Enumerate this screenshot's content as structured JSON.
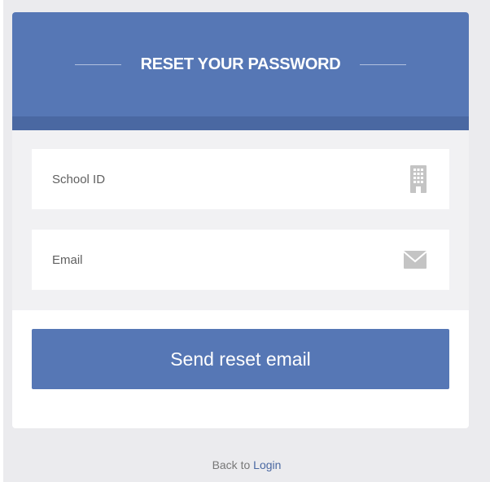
{
  "header": {
    "title": "RESET YOUR PASSWORD"
  },
  "form": {
    "school_id": {
      "placeholder": "School ID",
      "value": "",
      "icon": "building-icon"
    },
    "email": {
      "placeholder": "Email",
      "value": "",
      "icon": "envelope-icon"
    },
    "submit_label": "Send reset email"
  },
  "footer": {
    "prefix": "Back to",
    "link_label": "Login"
  },
  "colors": {
    "accent": "#5677b5",
    "accent_dark": "#4a68a2",
    "page_background": "#ebebee",
    "form_background": "#f1f1f3",
    "icon": "#c4c4c4"
  }
}
